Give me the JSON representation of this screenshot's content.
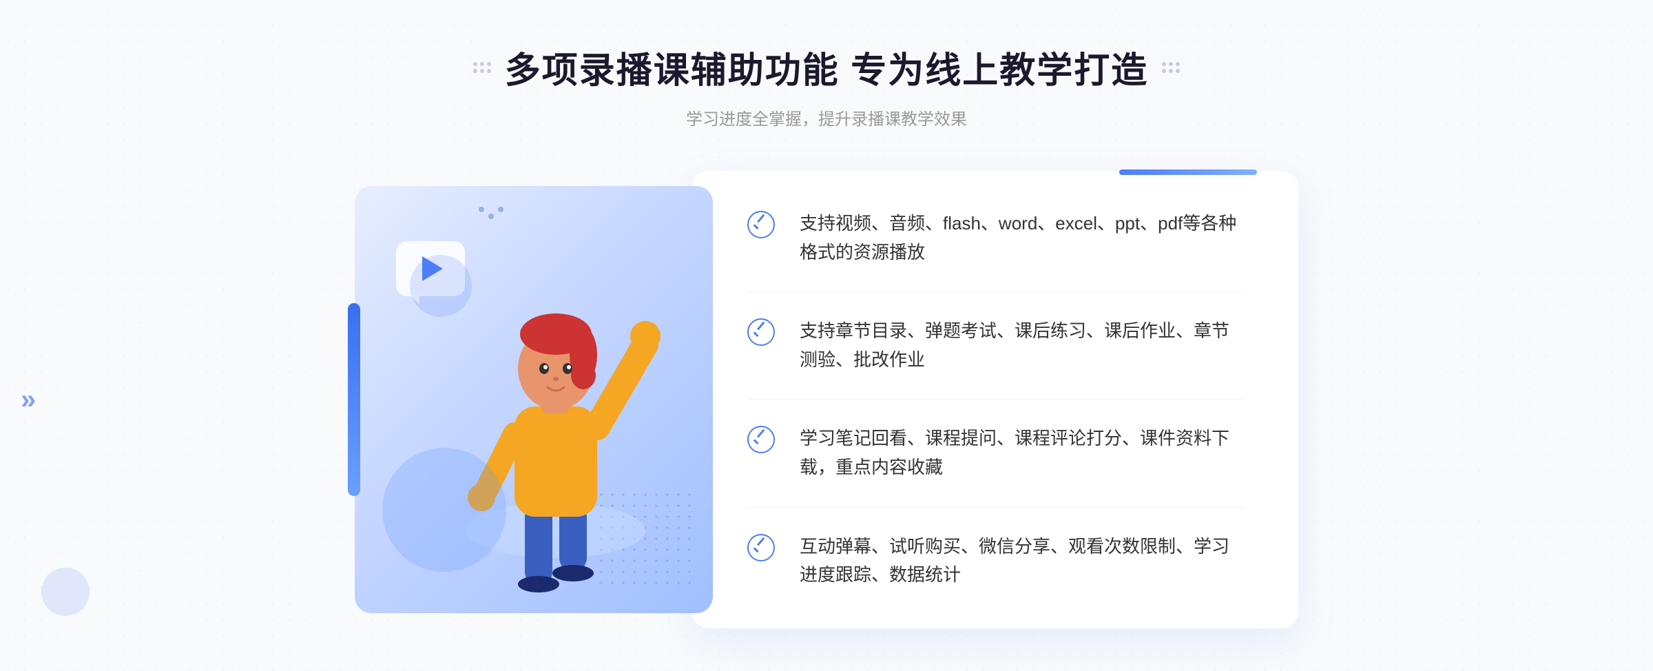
{
  "page": {
    "background_color": "#f9fafc"
  },
  "header": {
    "title": "多项录播课辅助功能 专为线上教学打造",
    "subtitle": "学习进度全掌握，提升录播课教学效果",
    "dots_left": "decorative",
    "dots_right": "decorative"
  },
  "features": [
    {
      "id": 1,
      "text": "支持视频、音频、flash、word、excel、ppt、pdf等各种格式的资源播放"
    },
    {
      "id": 2,
      "text": "支持章节目录、弹题考试、课后练习、课后作业、章节测验、批改作业"
    },
    {
      "id": 3,
      "text": "学习笔记回看、课程提问、课程评论打分、课件资料下载，重点内容收藏"
    },
    {
      "id": 4,
      "text": "互动弹幕、试听购买、微信分享、观看次数限制、学习进度跟踪、数据统计"
    }
  ],
  "illustration": {
    "play_button": "▶",
    "chevron_left": "«"
  }
}
